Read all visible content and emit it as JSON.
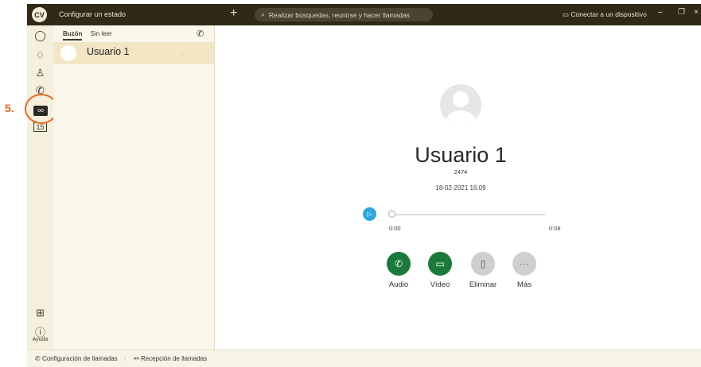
{
  "titlebar": {
    "avatar_initials": "CV",
    "status": "Configurar un estado",
    "new_icon": "+",
    "search_placeholder": "Realizar búsquedas, reunirse y hacer llamadas",
    "connect": "Conectar a un dispositivo",
    "minimize": "–",
    "restore": "❐",
    "close": "×"
  },
  "annotation": {
    "step": "5."
  },
  "leftbar": {
    "help_label": "Ayuda",
    "calendar_day": "15"
  },
  "listpane": {
    "tabs": [
      "Buzón",
      "Sin leer"
    ],
    "item": {
      "name": "Usuario 1"
    }
  },
  "detail": {
    "name": "Usuario 1",
    "number": "2474",
    "datetime": "18-02-2021 16:09",
    "time_start": "0:00",
    "time_end": "0:08",
    "actions": [
      "Audio",
      "Vídeo",
      "Eliminar",
      "Más"
    ]
  },
  "bottombar": {
    "call_settings": "Configuración de llamadas",
    "call_pickup": "Recepción de llamadas"
  }
}
